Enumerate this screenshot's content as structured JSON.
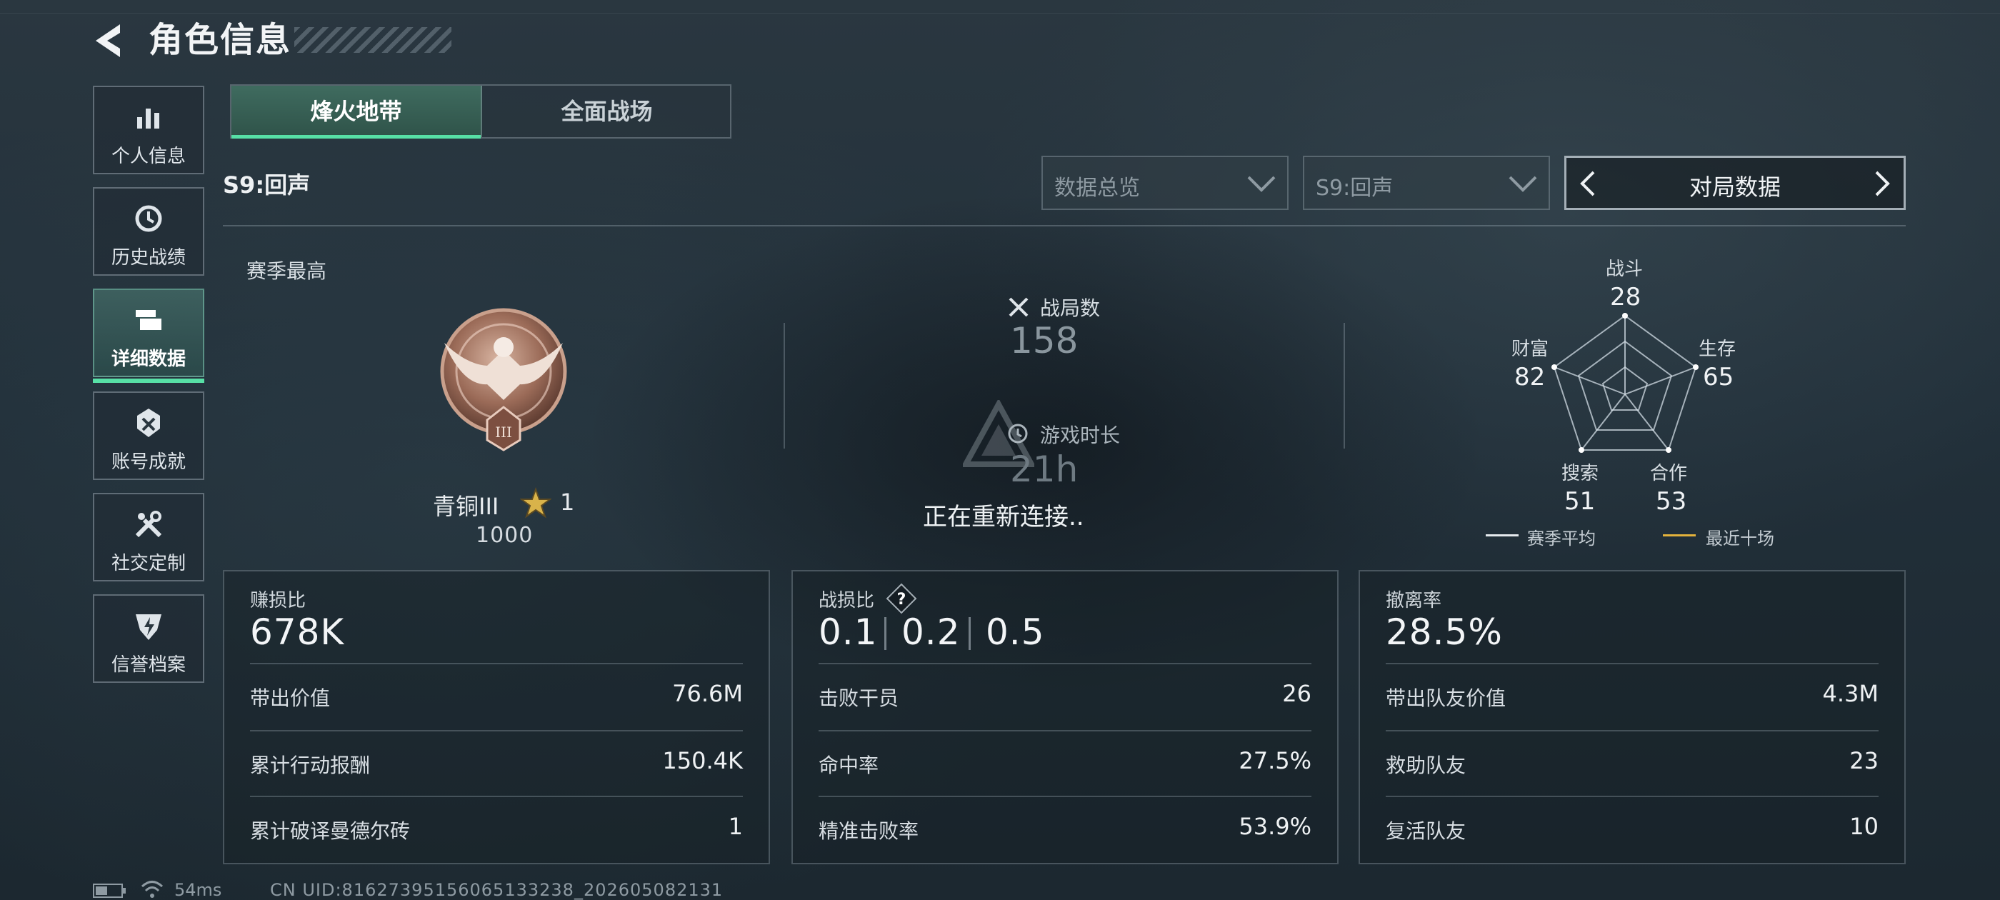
{
  "header": {
    "title": "角色信息"
  },
  "sidebar": {
    "items": [
      {
        "label": "个人信息",
        "icon": "bar-chart-icon"
      },
      {
        "label": "历史战绩",
        "icon": "history-clock-icon"
      },
      {
        "label": "详细数据",
        "icon": "stacked-cards-icon",
        "active": true
      },
      {
        "label": "账号成就",
        "icon": "achievement-badge-icon"
      },
      {
        "label": "社交定制",
        "icon": "tools-icon"
      },
      {
        "label": "信誉档案",
        "icon": "shield-bolt-icon"
      }
    ]
  },
  "tabs": [
    {
      "label": "烽火地带",
      "active": true
    },
    {
      "label": "全面战场"
    }
  ],
  "season": {
    "label": "S9:回声"
  },
  "filters": {
    "overview": "数据总览",
    "season": "S9:回声",
    "selector": "对局数据"
  },
  "season_best": {
    "label": "赛季最高",
    "rank": "青铜III",
    "stars": "1",
    "score": "1000"
  },
  "stats": {
    "matches_label": "战局数",
    "matches": "158",
    "playtime_label": "游戏时长",
    "playtime": "21h",
    "reconnecting": "正在重新连接.."
  },
  "radar": {
    "axes": [
      {
        "label": "战斗",
        "value": "28"
      },
      {
        "label": "生存",
        "value": "65"
      },
      {
        "label": "合作",
        "value": "53"
      },
      {
        "label": "搜索",
        "value": "51"
      },
      {
        "label": "财富",
        "value": "82"
      }
    ],
    "legend": [
      {
        "label": "赛季平均",
        "color": "#e6eaee"
      },
      {
        "label": "最近十场",
        "color": "#e3b23c"
      }
    ]
  },
  "cards": [
    {
      "title": "赚损比",
      "main": "678K",
      "rows": [
        {
          "label": "带出价值",
          "value": "76.6M"
        },
        {
          "label": "累计行动报酬",
          "value": "150.4K"
        },
        {
          "label": "累计破译曼德尔砖",
          "value": "1"
        }
      ]
    },
    {
      "title": "战损比",
      "ratios": [
        "0.1",
        "0.2",
        "0.5"
      ],
      "help": "?",
      "rows": [
        {
          "label": "击败干员",
          "value": "26"
        },
        {
          "label": "命中率",
          "value": "27.5%"
        },
        {
          "label": "精准击败率",
          "value": "53.9%"
        }
      ]
    },
    {
      "title": "撤离率",
      "main": "28.5%",
      "rows": [
        {
          "label": "带出队友价值",
          "value": "4.3M"
        },
        {
          "label": "救助队友",
          "value": "23"
        },
        {
          "label": "复活队友",
          "value": "10"
        }
      ]
    }
  ],
  "footer": {
    "ping": "54ms",
    "uid": "CN UID:81627395156065133238_202605082131"
  },
  "colors": {
    "accent": "#57e0a6",
    "gold": "#e3b23c"
  }
}
